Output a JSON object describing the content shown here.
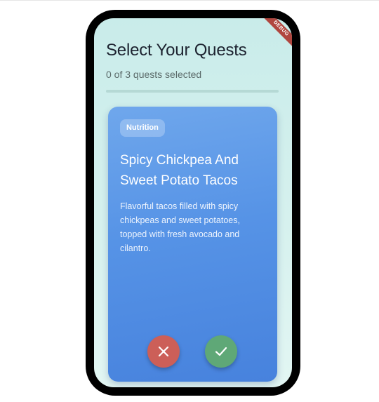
{
  "debug_banner": "DEBUG",
  "header": {
    "title": "Select Your Quests",
    "progress_text": "0 of 3 quests selected",
    "selected": 0,
    "total": 3
  },
  "card": {
    "category": "Nutrition",
    "title": "Spicy Chickpea And Sweet Potato Tacos",
    "description": "Flavorful tacos filled with spicy chickpeas and sweet potatoes, topped with fresh avocado and cilantro."
  },
  "actions": {
    "reject_icon": "close-icon",
    "accept_icon": "check-icon",
    "reject_color": "#cc5f58",
    "accept_color": "#5fa877"
  },
  "colors": {
    "card_accent": "#5693e6",
    "background": "#c9ecea"
  }
}
